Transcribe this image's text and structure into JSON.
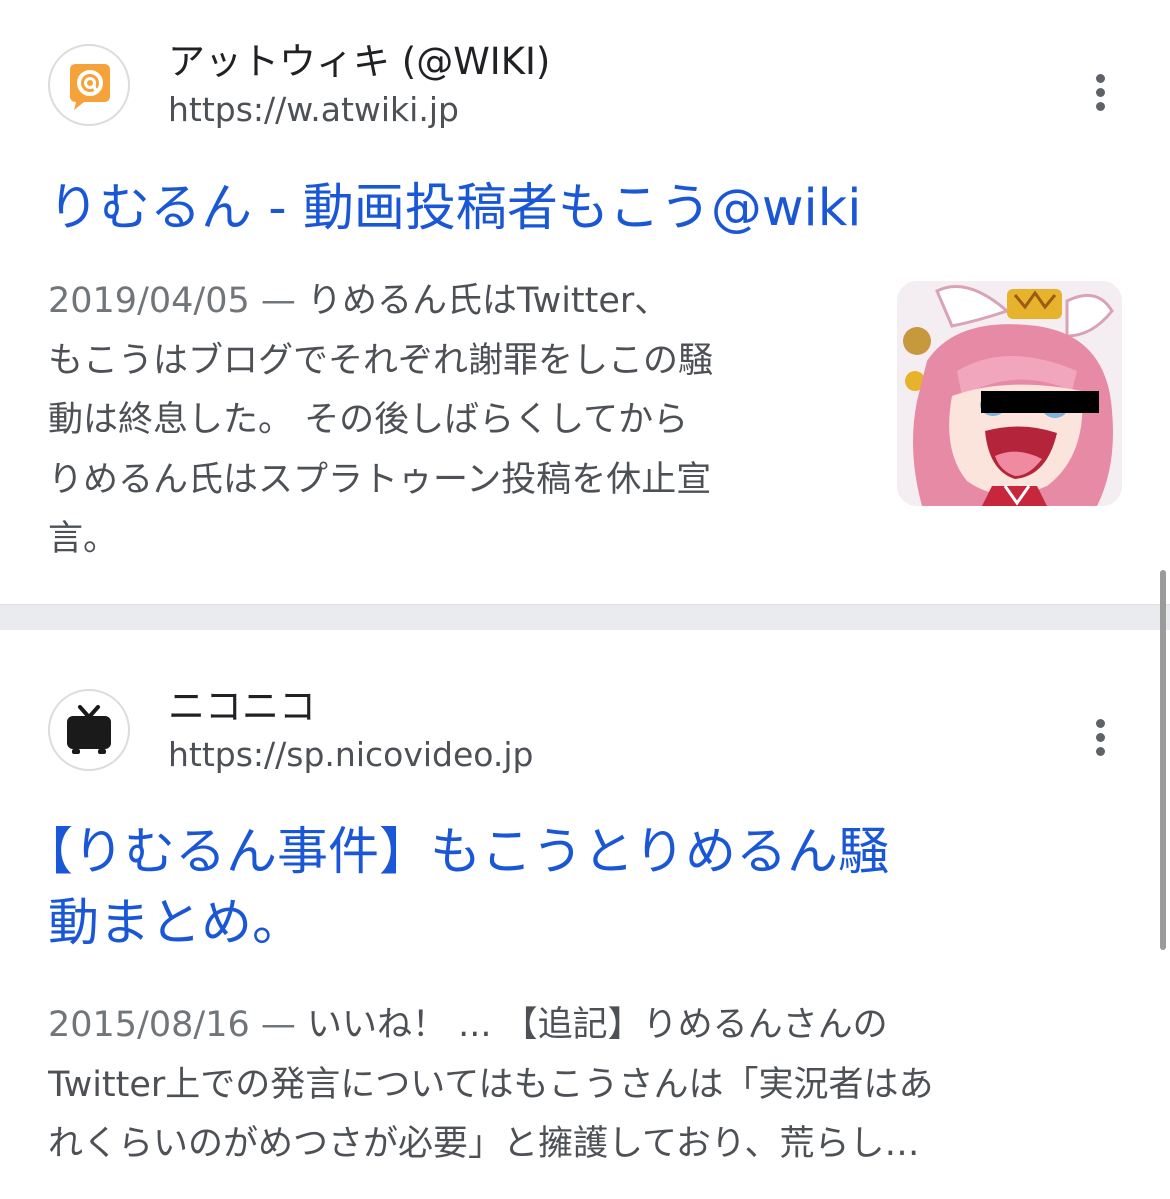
{
  "results": [
    {
      "site_name": "アットウィキ (@WIKI)",
      "site_url": "https://w.atwiki.jp",
      "favicon_icon": "atwiki-at-icon",
      "favicon_color": "#f5a23b",
      "title": "りむるん - 動画投稿者もこう@wiki",
      "date": "2019/04/05 — ",
      "snippet_lines": [
        "りめるん氏はTwitter、",
        "もこうはブログでそれぞれ謝罪をしこの騒",
        "動は終息した。 その後しばらくしてから",
        "りめるん氏はスプラトゥーン投稿を休止宣",
        "言。"
      ],
      "thumbnail_icon": "anime-character-thumbnail"
    },
    {
      "site_name": "ニコニコ",
      "site_url": "https://sp.nicovideo.jp",
      "favicon_icon": "niconico-tv-icon",
      "title_lines": [
        "【りむるん事件】もこうとりめるん騒",
        "動まとめ。"
      ],
      "date": "2015/08/16 — ",
      "snippet_lines": [
        "いいね！ ... 【追記】りめるんさんの",
        "Twitter上での発言についてはもこうさんは「実況者はあ",
        "れくらいのがめつさが必要」と擁護しており、荒らし…"
      ]
    }
  ],
  "colors": {
    "link": "#1a57d6",
    "snippet_text": "#4d5156",
    "site_name_text": "#202124",
    "divider": "#eaebef"
  },
  "icons": {
    "more_options": "more-vert-icon"
  }
}
